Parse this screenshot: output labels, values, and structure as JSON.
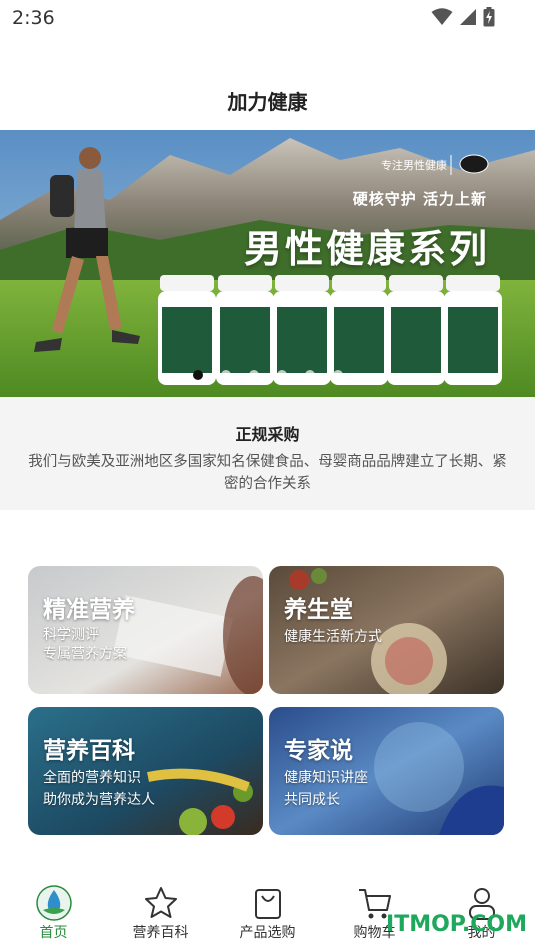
{
  "status_bar": {
    "time": "2:36"
  },
  "app": {
    "title": "加力健康"
  },
  "banner": {
    "brand": "专注男性健康",
    "slogan": "硬核守护 活力上新",
    "series": "男性健康系列",
    "slide_count": 6,
    "active_slide": 0
  },
  "info": {
    "title": "正规采购",
    "description": "我们与欧美及亚洲地区多国家知名保健食品、母婴商品品牌建立了长期、紧密的合作关系"
  },
  "cards": [
    {
      "title": "精准营养",
      "subtitle_lines": [
        "科学测评",
        "专属营养方案"
      ]
    },
    {
      "title": "养生堂",
      "subtitle_lines": [
        "健康生活新方式"
      ]
    },
    {
      "title": "营养百科",
      "subtitle_lines": [
        "全面的营养知识",
        "助你成为营养达人"
      ]
    },
    {
      "title": "专家说",
      "subtitle_lines": [
        "健康知识讲座",
        "共同成长"
      ]
    }
  ],
  "tabs": [
    {
      "label": "首页",
      "icon": "home-drop-icon",
      "active": true
    },
    {
      "label": "营养百科",
      "icon": "star-icon",
      "active": false
    },
    {
      "label": "产品选购",
      "icon": "shopping-bag-icon",
      "active": false
    },
    {
      "label": "购物车",
      "icon": "cart-icon",
      "active": false
    },
    {
      "label": "我的",
      "icon": "user-icon",
      "active": false
    }
  ],
  "watermark": "ITMOP.COM",
  "colors": {
    "accent_green": "#2a8a3e",
    "watermark": "#1ea85c",
    "info_bg": "#f4f4f4"
  }
}
